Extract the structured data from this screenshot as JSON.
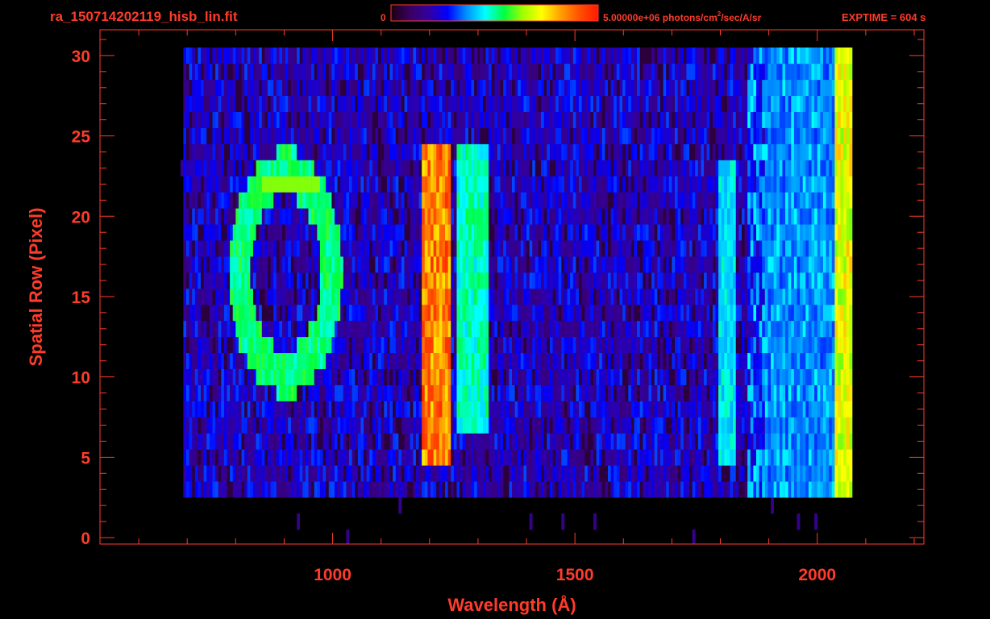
{
  "header": {
    "filename": "ra_150714202119_hisb_lin.fit",
    "exptime": "EXPTIME = 604 s"
  },
  "colorbar": {
    "min_label": "0",
    "max_label_pre": "5.00000e+06 photons/cm",
    "max_label_sup": "2",
    "max_label_post": "/sec/A/sr",
    "stops": [
      "#1a0010",
      "#3a0060",
      "#3300a0",
      "#0000ff",
      "#0090ff",
      "#00ffff",
      "#00ff40",
      "#a0ff00",
      "#ffff00",
      "#ffa000",
      "#ff5000",
      "#ff1800"
    ]
  },
  "colors": {
    "axis": "#ff3b2b",
    "background": "#000000"
  },
  "chart_data": {
    "type": "heatmap",
    "xlabel": "Wavelength (Å)",
    "ylabel": "Spatial Row (Pixel)",
    "xlim": [
      520,
      2220
    ],
    "ylim": [
      -0.4,
      31.6
    ],
    "xticks": [
      1000,
      1500,
      2000
    ],
    "yticks": [
      0,
      5,
      10,
      15,
      20,
      25,
      30
    ],
    "x_minor_step": 100,
    "y_minor_step": 1,
    "grid": false,
    "rows": 30,
    "row_start": 0.5,
    "background_region": {
      "x_min": 690,
      "x_max": 2070,
      "row_min": 3,
      "row_max": 30,
      "level": 0.22
    },
    "emission_features": [
      {
        "name": "bright-line",
        "x_min": 1180,
        "x_max": 1240,
        "row_min": 5,
        "row_max": 24,
        "level": 0.88
      },
      {
        "name": "line-1300",
        "x_min": 1255,
        "x_max": 1320,
        "row_min": 7,
        "row_max": 24,
        "level": 0.5
      },
      {
        "name": "line-1810",
        "x_min": 1795,
        "x_max": 1830,
        "row_min": 5,
        "row_max": 23,
        "level": 0.45
      },
      {
        "name": "edge-2060",
        "x_min": 2035,
        "x_max": 2070,
        "row_min": 0,
        "row_max": 30,
        "level": 0.72
      },
      {
        "name": "band-1950",
        "x_min": 1890,
        "x_max": 2030,
        "row_min": 3,
        "row_max": 30,
        "level": 0.35
      }
    ],
    "ring_feature": {
      "center_x": 900,
      "center_y": 16.5,
      "radius_x": 95,
      "radius_y": 6.2,
      "width": 22,
      "level": 0.55,
      "top_bar": {
        "x_min": 850,
        "x_max": 970,
        "row": 22,
        "level": 0.62
      }
    }
  }
}
